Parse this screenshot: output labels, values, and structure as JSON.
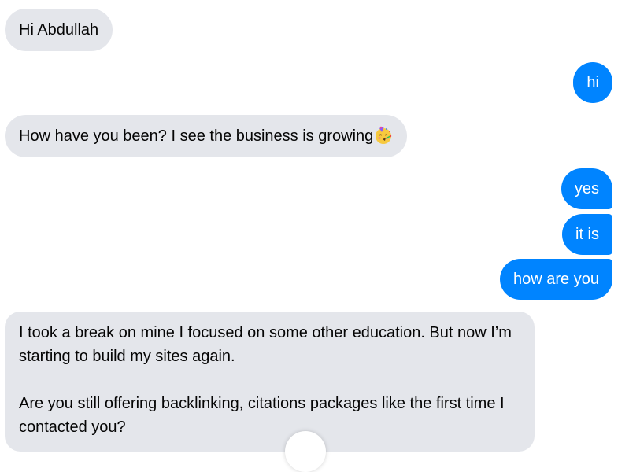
{
  "messages": [
    {
      "direction": "incoming",
      "text": "Hi Abdullah"
    },
    {
      "direction": "outgoing",
      "text": "hi"
    },
    {
      "direction": "incoming",
      "text": "How have you been? I see the business is growing",
      "emoji": "partying-face-emoji"
    },
    {
      "direction": "outgoing",
      "text": "yes"
    },
    {
      "direction": "outgoing",
      "text": "it is"
    },
    {
      "direction": "outgoing",
      "text": "how are you"
    },
    {
      "direction": "incoming",
      "paragraph1": "I took a break on mine I focused on some other education. But now I’m starting to build my sites again.",
      "paragraph2": "Are you still offering backlinking, citations packages like the first time I contacted you?"
    }
  ],
  "colors": {
    "incoming_bubble": "#e4e6eb",
    "outgoing_bubble": "#0084ff",
    "outgoing_text": "#ffffff",
    "incoming_text": "#050505"
  },
  "icons": {
    "scroll_button": "scroll-to-bottom-button"
  }
}
